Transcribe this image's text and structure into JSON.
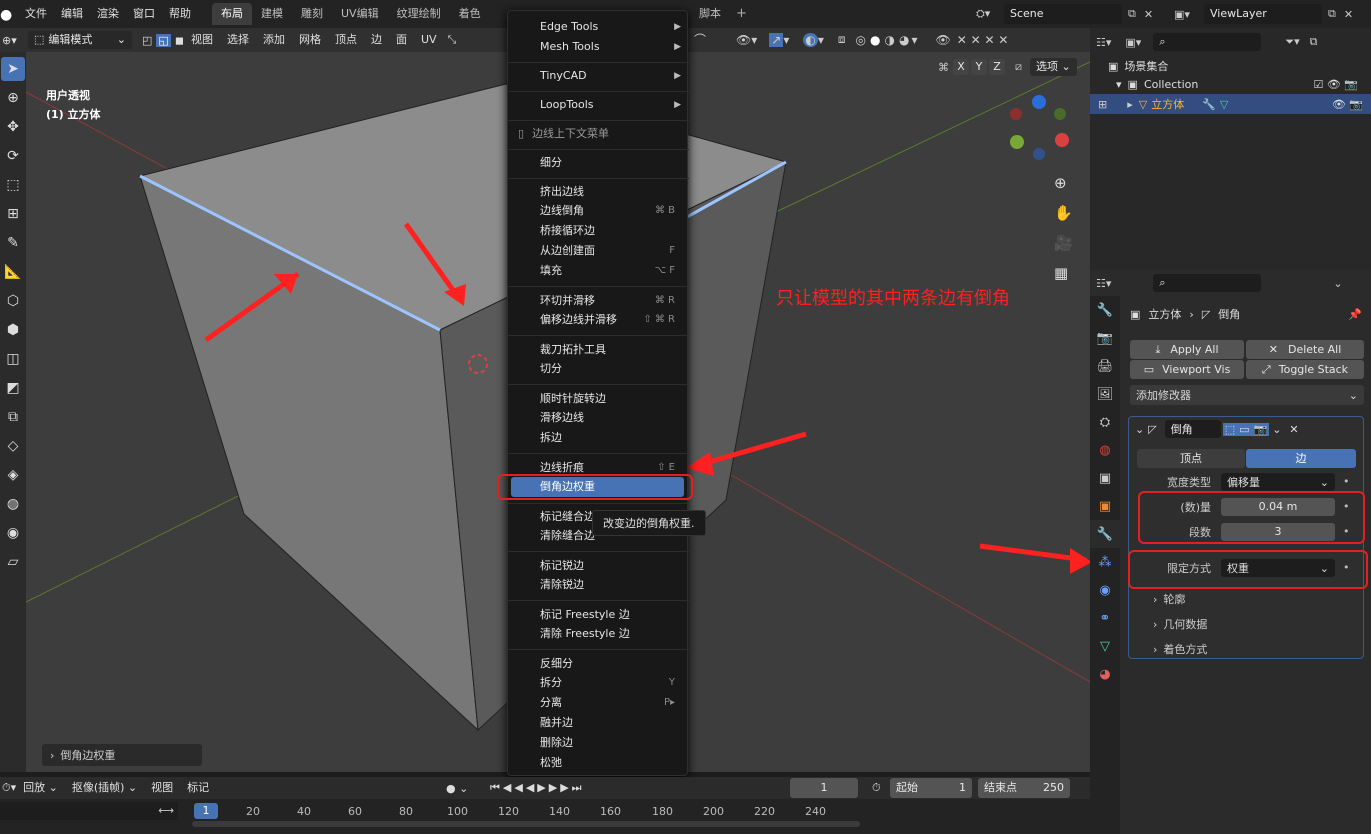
{
  "menu": {
    "file": "文件",
    "edit": "编辑",
    "render": "渲染",
    "window": "窗口",
    "help": "帮助"
  },
  "workspaces": [
    "布局",
    "建模",
    "雕刻",
    "UV编辑",
    "纹理绘制",
    "着色"
  ],
  "workspace_extra": {
    "script": "脚本",
    "plus": "+"
  },
  "scene": {
    "label": "Scene",
    "viewlayer": "ViewLayer"
  },
  "viewport_header": {
    "mode": "编辑模式",
    "items": [
      "视图",
      "选择",
      "添加",
      "网格",
      "顶点",
      "边",
      "面",
      "UV"
    ],
    "options": "选项",
    "axes": [
      "X",
      "Y",
      "Z"
    ]
  },
  "viewport": {
    "view_name": "用户透视",
    "object_name": "(1) 立方体",
    "last_op": "倒角边权重"
  },
  "context_menu": {
    "items": [
      {
        "label": "Edge Tools",
        "sub": true
      },
      {
        "label": "Mesh Tools",
        "sub": true
      },
      {
        "label": "TinyCAD",
        "sub": true
      },
      {
        "label": "LoopTools",
        "sub": true
      },
      {
        "label": "边线上下文菜单",
        "header": true
      },
      {
        "label": "细分"
      },
      {
        "label": "挤出边线"
      },
      {
        "label": "边线倒角",
        "shortcut": "⌘ B"
      },
      {
        "label": "桥接循环边"
      },
      {
        "label": "从边创建面",
        "shortcut": "F"
      },
      {
        "label": "填充",
        "shortcut": "⌥ F"
      },
      {
        "label": "环切并滑移",
        "shortcut": "⌘ R"
      },
      {
        "label": "偏移边线并滑移",
        "shortcut": "⇧ ⌘ R"
      },
      {
        "label": "裁刀拓扑工具"
      },
      {
        "label": "切分"
      },
      {
        "label": "顺时针旋转边"
      },
      {
        "label": "滑移边线"
      },
      {
        "label": "拆边"
      },
      {
        "label": "边线折痕",
        "shortcut": "⇧ E"
      },
      {
        "label": "倒角边权重",
        "highlight": true
      },
      {
        "label": "标记缝合边"
      },
      {
        "label": "清除缝合边"
      },
      {
        "label": "标记锐边"
      },
      {
        "label": "清除锐边"
      },
      {
        "label": "标记 Freestyle 边"
      },
      {
        "label": "清除 Freestyle 边"
      },
      {
        "label": "反细分"
      },
      {
        "label": "拆分",
        "shortcut": "Y"
      },
      {
        "label": "分离",
        "shortcut": "P▸"
      },
      {
        "label": "融并边"
      },
      {
        "label": "删除边"
      },
      {
        "label": "松弛"
      }
    ],
    "tooltip": "改变边的倒角权重."
  },
  "annotation": "只让模型的其中两条边有倒角",
  "outliner": {
    "scene_collection": "场景集合",
    "collection": "Collection",
    "object": "立方体"
  },
  "properties": {
    "breadcrumb_obj": "立方体",
    "breadcrumb_mod": "倒角",
    "apply_all": "Apply All",
    "delete_all": "Delete All",
    "viewport_vis": "Viewport Vis",
    "toggle_stack": "Toggle Stack",
    "add_modifier": "添加修改器",
    "modifier_name": "倒角",
    "tab_vertex": "顶点",
    "tab_edge": "边",
    "width_type_label": "宽度类型",
    "width_type_value": "偏移量",
    "amount_label": "(数)量",
    "amount_value": "0.04 m",
    "segments_label": "段数",
    "segments_value": "3",
    "limit_label": "限定方式",
    "limit_value": "权重",
    "sub_profile": "轮廓",
    "sub_geometry": "几何数据",
    "sub_shading": "着色方式"
  },
  "timeline": {
    "playback": "回放",
    "keying": "抠像(插帧)",
    "view": "视图",
    "marker": "标记",
    "current": "1",
    "start_label": "起始",
    "start": "1",
    "end_label": "结束点",
    "end": "250",
    "ticks": [
      "1",
      "20",
      "40",
      "60",
      "80",
      "100",
      "120",
      "140",
      "160",
      "180",
      "200",
      "220",
      "240"
    ]
  }
}
